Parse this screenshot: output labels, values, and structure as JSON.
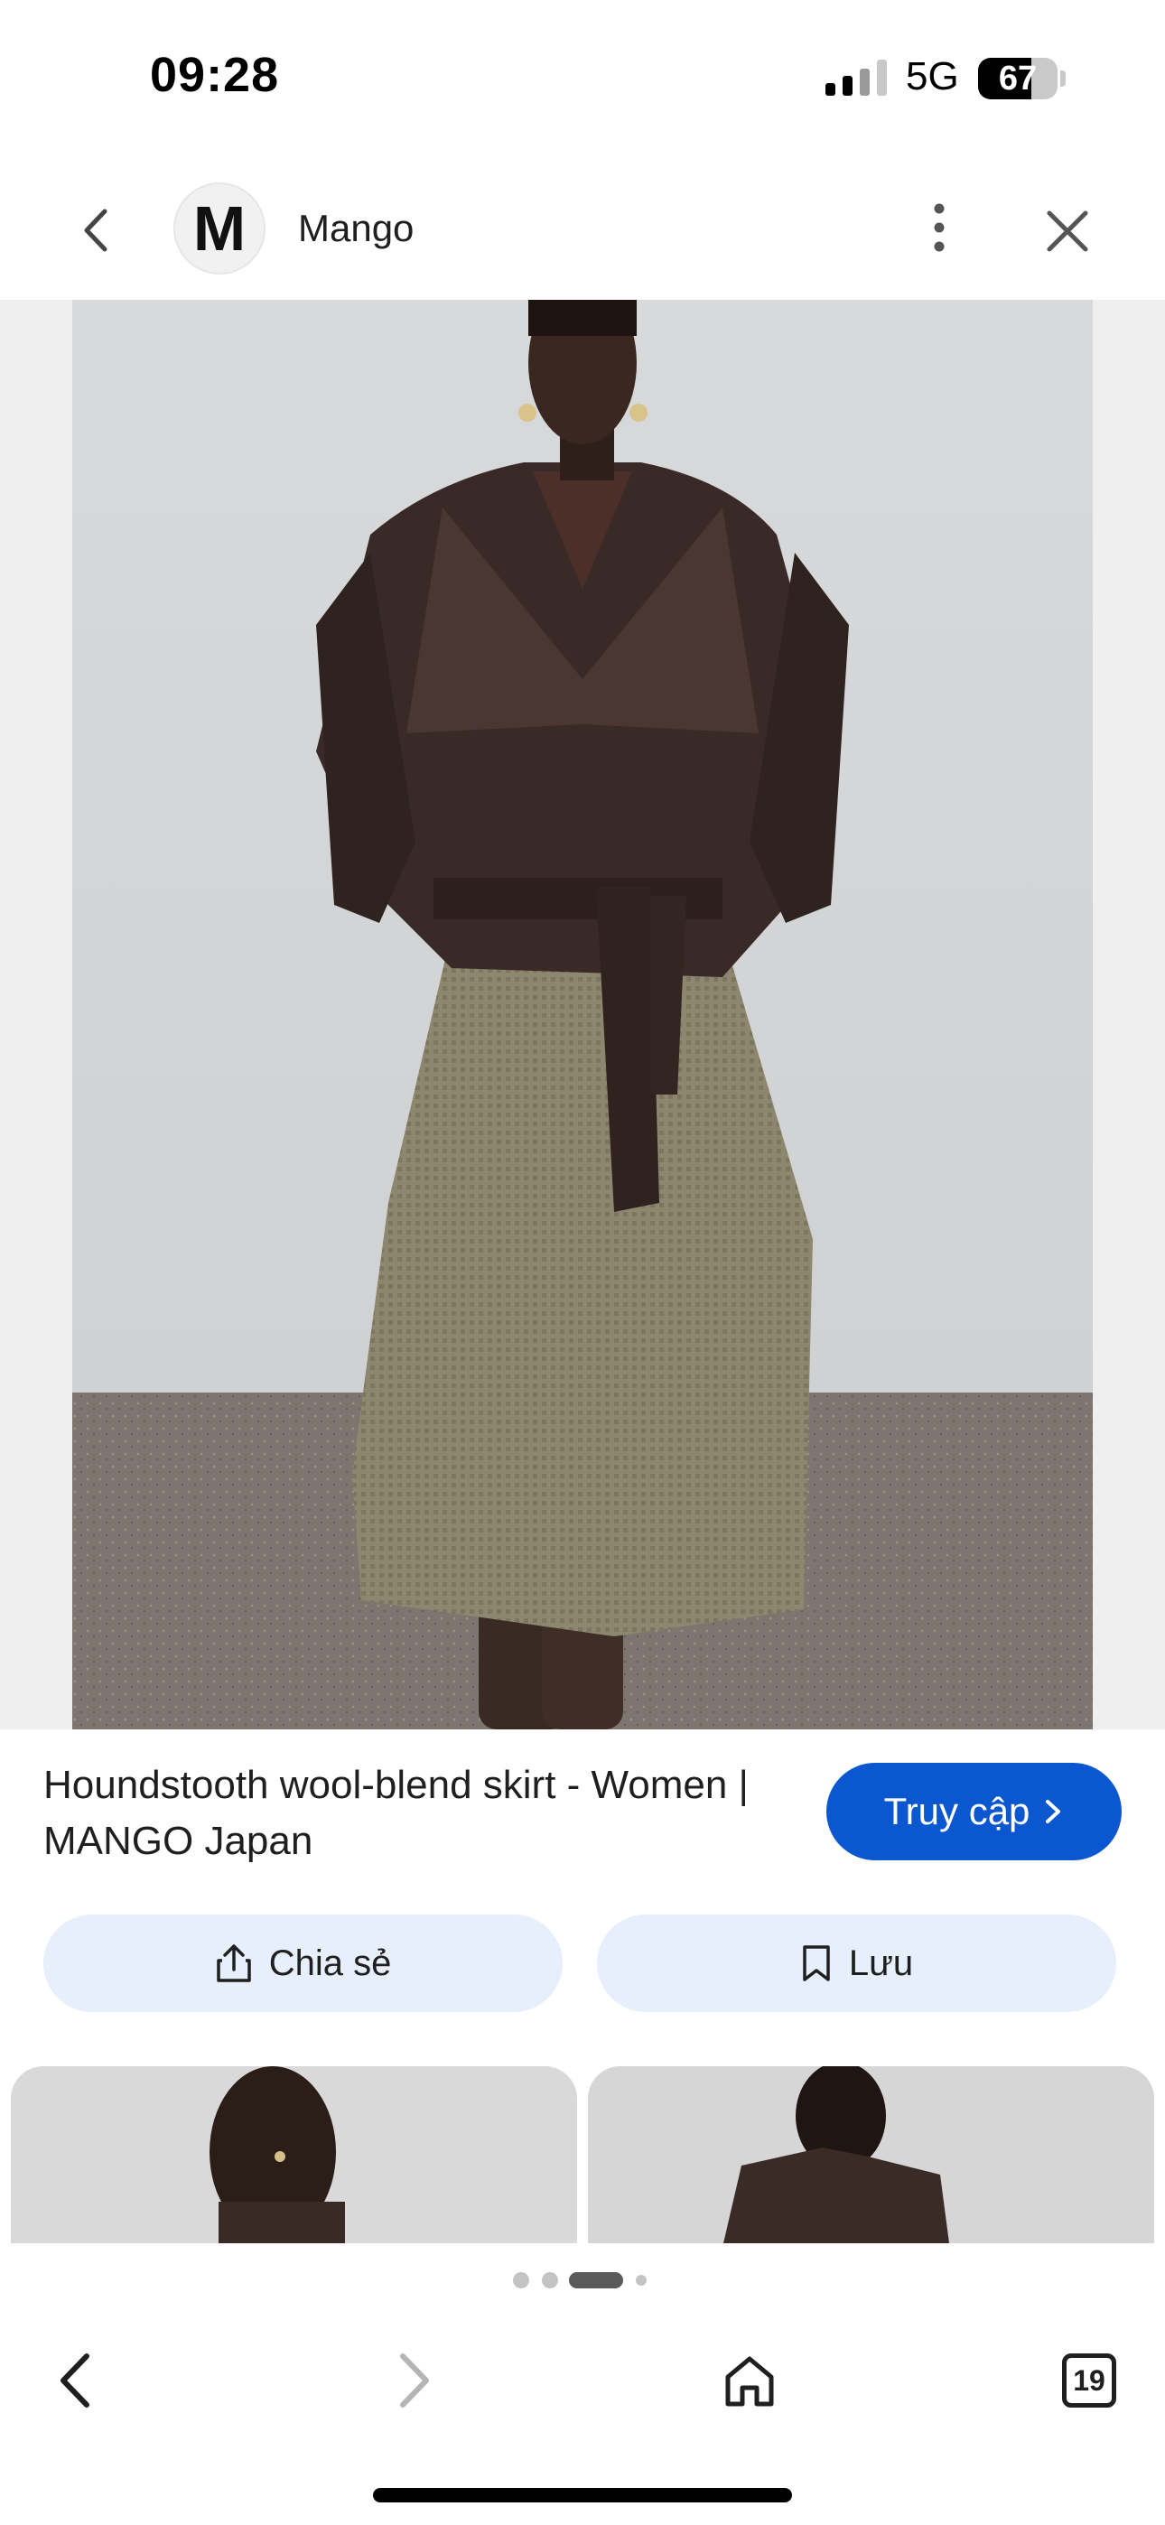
{
  "status_bar": {
    "time": "09:28",
    "network": "5G",
    "battery": "67"
  },
  "header": {
    "back_icon": "chevron-left-icon",
    "site_logo_letter": "M",
    "site_name": "Mango",
    "more_icon": "more-vertical-icon",
    "close_icon": "close-icon"
  },
  "product": {
    "title": "Houndstooth wool-blend skirt - Women | MANGO Japan",
    "visit_label": "Truy cập",
    "share_label": "Chia sẻ",
    "save_label": "Lưu"
  },
  "pager": {
    "count": 4,
    "active_index": 2
  },
  "bottom_nav": {
    "back_icon": "back-icon",
    "forward_icon": "forward-icon",
    "home_icon": "home-icon",
    "tab_count": "19"
  },
  "colors": {
    "accent": "#0b57d0",
    "pill_bg": "#e7effd"
  }
}
